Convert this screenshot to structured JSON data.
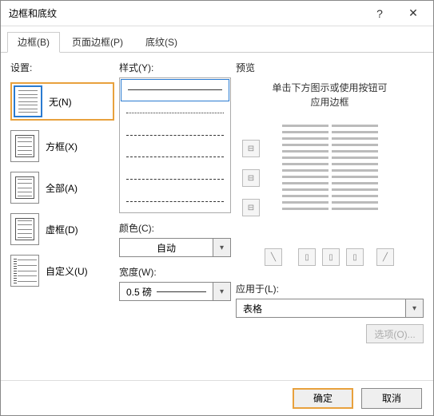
{
  "window": {
    "title": "边框和底纹",
    "help": "?",
    "close": "✕"
  },
  "tabs": {
    "borders": "边框(B)",
    "page_borders": "页面边框(P)",
    "shading": "底纹(S)"
  },
  "settings": {
    "label": "设置:",
    "none": "无(N)",
    "box": "方框(X)",
    "all": "全部(A)",
    "grid": "虚框(D)",
    "custom": "自定义(U)"
  },
  "style": {
    "label": "样式(Y):",
    "color_label": "颜色(C):",
    "color_value": "自动",
    "width_label": "宽度(W):",
    "width_value": "0.5 磅"
  },
  "preview": {
    "label": "预览",
    "hint1": "单击下方图示或使用按钮可",
    "hint2": "应用边框",
    "apply_label": "应用于(L):",
    "apply_value": "表格",
    "options": "选项(O)..."
  },
  "footer": {
    "ok": "确定",
    "cancel": "取消"
  }
}
